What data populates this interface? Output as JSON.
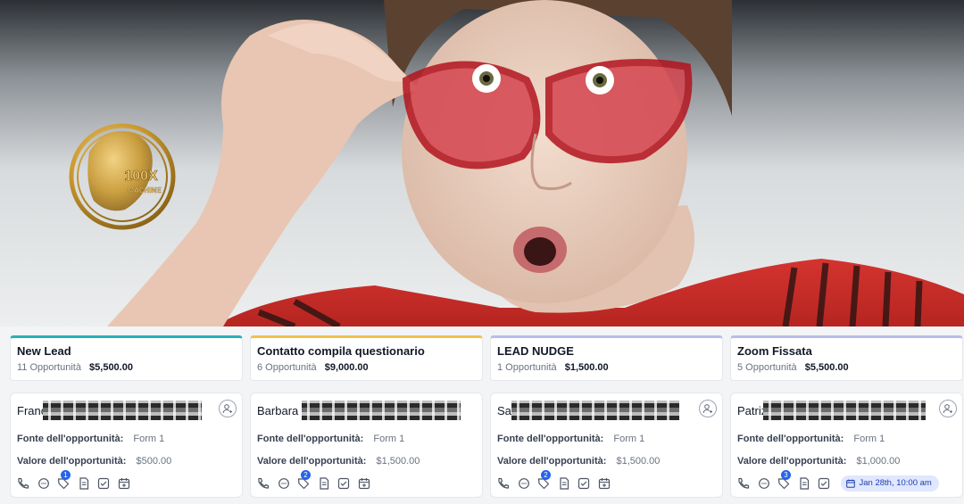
{
  "hero": {
    "logo_text": "100X MACHINE",
    "logo_color": "#c9982f",
    "description": "banner photo"
  },
  "colors": {
    "new_lead": "#2ab0b7",
    "contatto": "#f2c04d",
    "lead_nudge": "#b7bde8",
    "zoom": "#b7bde8",
    "badge": "#2563eb",
    "chip_bg": "#e0e7ff"
  },
  "columns": [
    {
      "title": "New Lead",
      "count": "11 Opportunità",
      "amount": "$5,500.00",
      "card": {
        "name": "Franc",
        "source_label": "Fonte dell'opportunità:",
        "source_value": "Form 1",
        "value_label": "Valore dell'opportunità:",
        "value_value": "$500.00",
        "notif_count": "1"
      }
    },
    {
      "title": "Contatto compila questionario",
      "count": "6 Opportunità",
      "amount": "$9,000.00",
      "card": {
        "name": "Barbara",
        "source_label": "Fonte dell'opportunità:",
        "source_value": "Form 1",
        "value_label": "Valore dell'opportunità:",
        "value_value": "$1,500.00",
        "notif_count": "2"
      }
    },
    {
      "title": "LEAD NUDGE",
      "count": "1 Opportunità",
      "amount": "$1,500.00",
      "card": {
        "name": "Sar",
        "source_label": "Fonte dell'opportunità:",
        "source_value": "Form 1",
        "value_label": "Valore dell'opportunità:",
        "value_value": "$1,500.00",
        "notif_count": "2"
      }
    },
    {
      "title": "Zoom Fissata",
      "count": "5 Opportunità",
      "amount": "$5,500.00",
      "card": {
        "name": "Patriz",
        "source_label": "Fonte dell'opportunità:",
        "source_value": "Form 1",
        "value_label": "Valore dell'opportunità:",
        "value_value": "$1,000.00",
        "notif_count": "3",
        "appointment": "Jan 28th, 10:00 am"
      }
    }
  ]
}
